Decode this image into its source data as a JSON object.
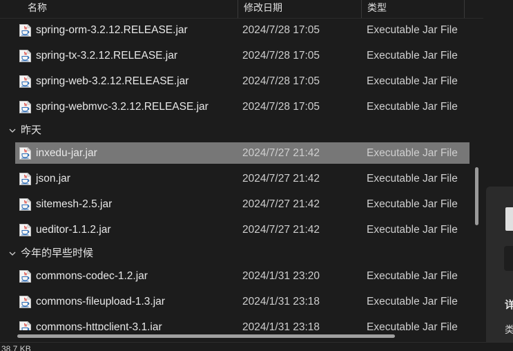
{
  "columns": {
    "name": "名称",
    "date_modified": "修改日期",
    "type": "类型"
  },
  "list": [
    {
      "kind": "file",
      "name": "spring-orm-3.2.12.RELEASE.jar",
      "date": "2024/7/28 17:05",
      "type": "Executable Jar File",
      "selected": false
    },
    {
      "kind": "file",
      "name": "spring-tx-3.2.12.RELEASE.jar",
      "date": "2024/7/28 17:05",
      "type": "Executable Jar File",
      "selected": false
    },
    {
      "kind": "file",
      "name": "spring-web-3.2.12.RELEASE.jar",
      "date": "2024/7/28 17:05",
      "type": "Executable Jar File",
      "selected": false
    },
    {
      "kind": "file",
      "name": "spring-webmvc-3.2.12.RELEASE.jar",
      "date": "2024/7/28 17:05",
      "type": "Executable Jar File",
      "selected": false
    },
    {
      "kind": "group",
      "label": "昨天"
    },
    {
      "kind": "file",
      "name": "inxedu-jar.jar",
      "date": "2024/7/27 21:42",
      "type": "Executable Jar File",
      "selected": true
    },
    {
      "kind": "file",
      "name": "json.jar",
      "date": "2024/7/27 21:42",
      "type": "Executable Jar File",
      "selected": false
    },
    {
      "kind": "file",
      "name": "sitemesh-2.5.jar",
      "date": "2024/7/27 21:42",
      "type": "Executable Jar File",
      "selected": false
    },
    {
      "kind": "file",
      "name": "ueditor-1.1.2.jar",
      "date": "2024/7/27 21:42",
      "type": "Executable Jar File",
      "selected": false
    },
    {
      "kind": "group",
      "label": "今年的早些时候"
    },
    {
      "kind": "file",
      "name": "commons-codec-1.2.jar",
      "date": "2024/1/31 23:20",
      "type": "Executable Jar File",
      "selected": false
    },
    {
      "kind": "file",
      "name": "commons-fileupload-1.3.jar",
      "date": "2024/1/31 23:18",
      "type": "Executable Jar File",
      "selected": false
    },
    {
      "kind": "file",
      "name": "commons-httpclient-3.1.jar",
      "date": "2024/1/31 23:18",
      "type": "Executable Jar File",
      "selected": false
    }
  ],
  "details": {
    "heading": "详",
    "type_label": "类"
  },
  "status": {
    "size_text": "i 38.7 KB"
  },
  "colors": {
    "background": "#1c1c1c",
    "selected_row": "#777777",
    "java_icon_red": "#d9332b",
    "java_icon_blue": "#2f6db5"
  },
  "icons": {
    "file": "java-jar-icon",
    "group": "chevron-down-icon"
  }
}
